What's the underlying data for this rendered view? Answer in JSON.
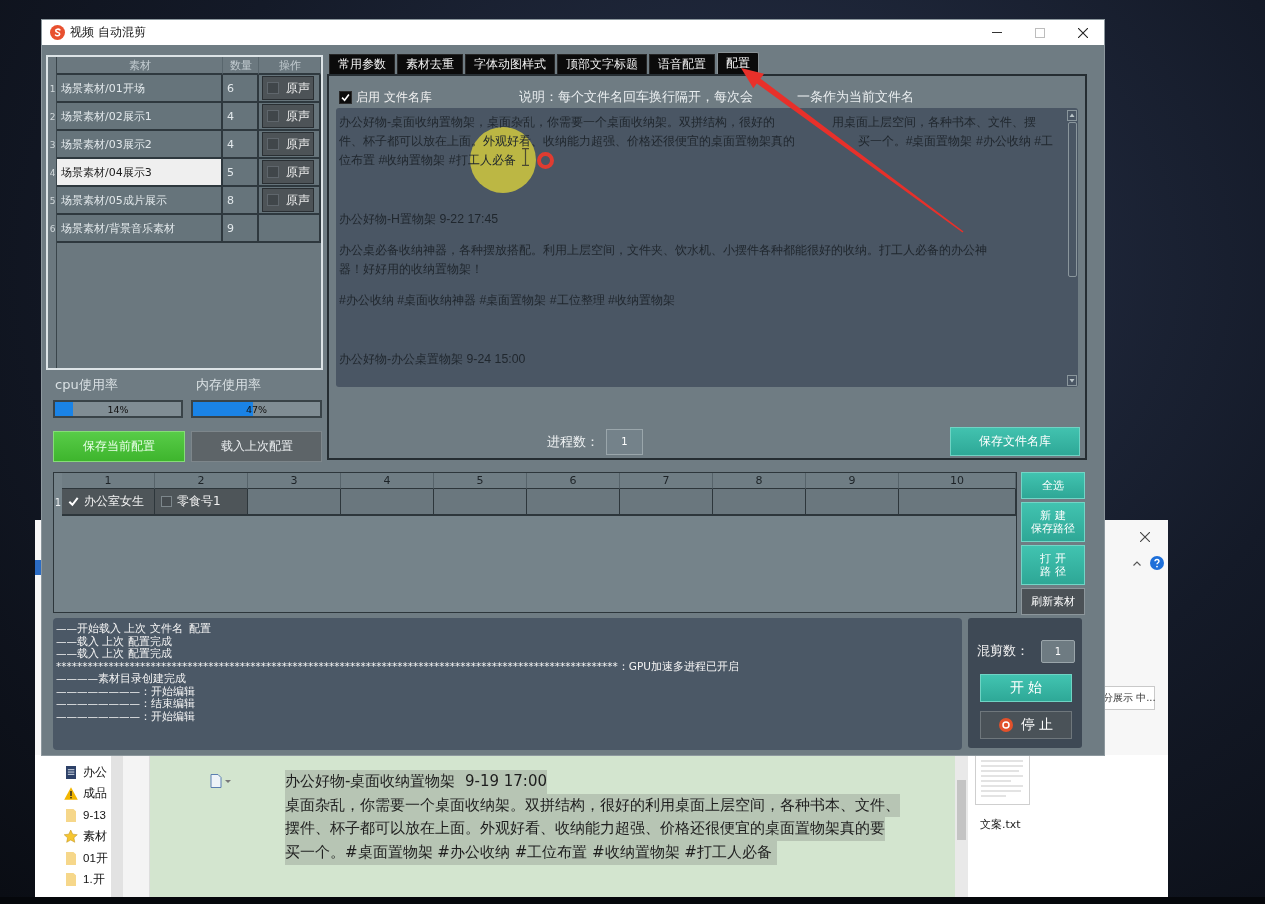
{
  "window": {
    "title": "视频 自动混剪"
  },
  "material_table": {
    "columns": [
      "素材",
      "数量",
      "操作"
    ],
    "rows": [
      {
        "index": "1",
        "material": "场景素材/01开场",
        "count": "6",
        "selected": false,
        "action": {
          "label": "原声",
          "checked": false
        }
      },
      {
        "index": "2",
        "material": "场景素材/02展示1",
        "count": "4",
        "selected": false,
        "action": {
          "label": "原声",
          "checked": false
        }
      },
      {
        "index": "3",
        "material": "场景素材/03展示2",
        "count": "4",
        "selected": false,
        "action": {
          "label": "原声",
          "checked": false
        }
      },
      {
        "index": "4",
        "material": "场景素材/04展示3",
        "count": "5",
        "selected": true,
        "action": {
          "label": "原声",
          "checked": false
        }
      },
      {
        "index": "5",
        "material": "场景素材/05成片展示",
        "count": "8",
        "selected": false,
        "action": {
          "label": "原声",
          "checked": false
        }
      },
      {
        "index": "6",
        "material": "场景素材/背景音乐素材",
        "count": "9",
        "selected": false
      }
    ]
  },
  "usage": [
    {
      "label": "cpu使用率",
      "level": 0.14,
      "reading": "14%"
    },
    {
      "label": "内存使用率",
      "level": 0.47,
      "reading": "47%"
    }
  ],
  "config_buttons": [
    {
      "label": "保存当前配置",
      "kind": "primary"
    },
    {
      "label": "载入上次配置",
      "kind": "secondary"
    }
  ],
  "tabs": [
    {
      "label": "常用参数",
      "selected": false
    },
    {
      "label": "素材去重",
      "selected": false
    },
    {
      "label": "字体动图样式",
      "selected": false
    },
    {
      "label": "顶部文字标题",
      "selected": false
    },
    {
      "label": "语音配置",
      "selected": false
    },
    {
      "label": "配置",
      "selected": true
    }
  ],
  "filename_library": {
    "enable": {
      "label": "启用 文件名库",
      "checked": true
    },
    "note": [
      "说明：每个文件名回车换行隔开，每次会",
      "一条作为当前文件名"
    ],
    "lines": [
      {
        "kind": "paragraph",
        "parts": [
          "办公好物-桌面收纳置物架，桌面杂乱，你需要一个桌面收纳架。双拼结构，很好的",
          "用桌面上层空间，各种书本、文件、摆"
        ]
      },
      {
        "kind": "continuation",
        "parts": [
          "件、杯子都可以放在上面。外观好看、收纳能力超强、价格还很便宜的桌面置物架真的",
          "买一个。#桌面置物架 #办公收纳 #工"
        ]
      },
      {
        "kind": "continuation",
        "parts": [
          "位布置 #收纳置物架 #打工人必备"
        ]
      },
      {
        "kind": "heading",
        "parts": [
          "办公好物-H置物架 9-22 17:45"
        ]
      },
      {
        "kind": "paragraph",
        "parts": [
          "办公桌必备收纳神器，各种摆放搭配。利用上层空间，文件夹、饮水机、小摆件各种都能很好的收纳。打工人必备的办公神"
        ]
      },
      {
        "kind": "continuation",
        "parts": [
          "器！好好用的收纳置物架！"
        ]
      },
      {
        "kind": "paragraph",
        "parts": [
          "#办公收纳 #桌面收纳神器 #桌面置物架 #工位整理 #收纳置物架"
        ]
      },
      {
        "kind": "heading",
        "parts": [
          "办公好物-办公桌置物架 9-24 15:00"
        ]
      }
    ],
    "process_count": {
      "label": "进程数：",
      "value": "1"
    },
    "save_button": "保存文件名库"
  },
  "output_grid": {
    "columns": [
      "1",
      "2",
      "3",
      "4",
      "5",
      "6",
      "7",
      "8",
      "9",
      "10"
    ],
    "rows": [
      {
        "index": "1",
        "cells": [
          {
            "label": "办公室女生",
            "checked": true
          },
          {
            "label": "零食号1",
            "checked": false
          }
        ]
      }
    ]
  },
  "grid_buttons": [
    {
      "lines": [
        "全选"
      ],
      "kind": "accent"
    },
    {
      "lines": [
        "新 建",
        "保存路径"
      ],
      "kind": "accent"
    },
    {
      "lines": [
        "打 开",
        "路 径"
      ],
      "kind": "accent"
    },
    {
      "lines": [
        "刷新素材"
      ],
      "kind": "plain"
    }
  ],
  "log": {
    "lines": [
      "——开始载入 上次 文件名  配置",
      "——载入 上次 配置完成",
      "——载入 上次 配置完成",
      "***********************************************************************************************************：GPU加速多进程已开启",
      "————素材目录创建完成",
      "————————：开始编辑",
      "————————：结束编辑",
      "————————：开始编辑"
    ]
  },
  "run_panel": {
    "mix_count": {
      "label": "混剪数：",
      "value": "1"
    },
    "start_button": "开 始",
    "stop_button": "停 止"
  },
  "document_window": {
    "style_box": "分展示 中...",
    "nav_items": [
      {
        "kind": "document",
        "label": "办公"
      },
      {
        "kind": "warning",
        "label": "成品"
      },
      {
        "kind": "folder",
        "label": "9-13"
      },
      {
        "kind": "star",
        "label": "素材"
      },
      {
        "kind": "folder",
        "label": "01开"
      },
      {
        "kind": "folder",
        "label": "1.开"
      }
    ],
    "lines": [
      {
        "text": "办公好物-桌面收纳置物架  9-19 17:00",
        "selected": true
      },
      {
        "text": "桌面杂乱，你需要一个桌面收纳架。双拼结构，很好的利用桌面上层空间，各种书本、文件、",
        "selected": true
      },
      {
        "text": "摆件、杯子都可以放在上面。外观好看、收纳能力超强、价格还很便宜的桌面置物架真的要",
        "selected": true
      },
      {
        "text": "买一个。#桌面置物架 #办公收纳 #工位布置 #收纳置物架 #打工人必备 ",
        "selected": true
      }
    ],
    "file": "文案.txt"
  }
}
